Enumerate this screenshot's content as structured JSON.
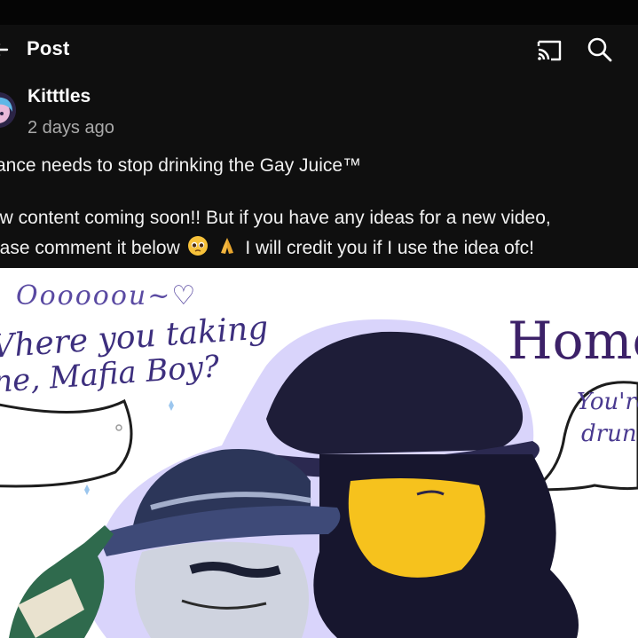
{
  "header": {
    "title": "Post",
    "back_icon": "back-arrow-icon",
    "cast_icon": "cast-icon",
    "search_icon": "search-icon"
  },
  "post": {
    "author": "Kitttles",
    "timestamp": "2 days ago",
    "lines": [
      "ance needs to stop drinking the Gay Juice™",
      "ew content coming soon!! But if you have any ideas for a new video,",
      "ease comment it below",
      "I will credit you if I use the idea ofc!"
    ],
    "emojis": [
      "pleading-face-emoji",
      "folded-hands-emoji"
    ]
  },
  "artwork": {
    "oooo": "Oooooou~♡",
    "where": "Vhere you taking",
    "mafia": "ne, Mafia Boy?",
    "home": "Home",
    "youre": "You're",
    "drunk": "drun"
  },
  "colors": {
    "background": "#0f0f0f",
    "text": "#f1f1f1",
    "muted": "#aaaaaa",
    "art_ink": "#3d2f7e",
    "art_glow": "#b9b4f2"
  }
}
